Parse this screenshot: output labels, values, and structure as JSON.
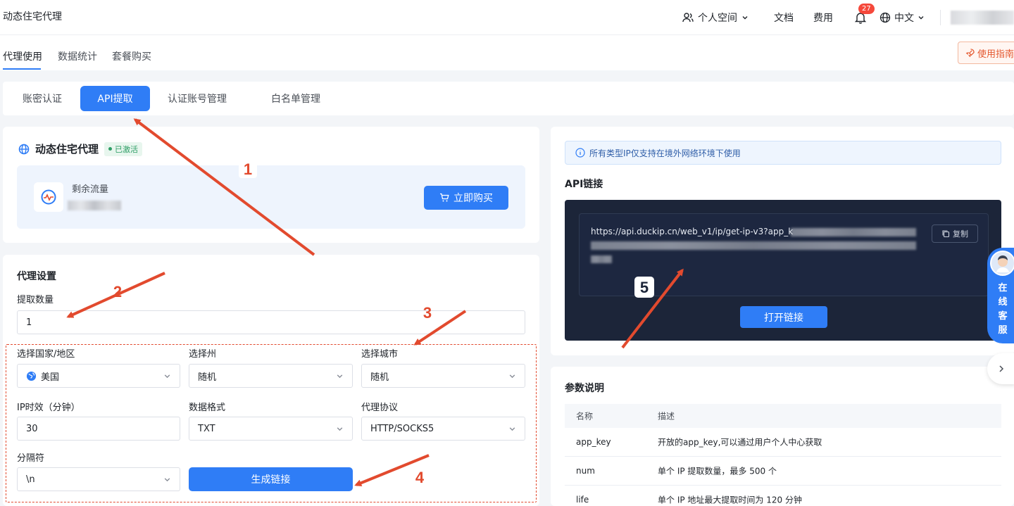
{
  "header": {
    "brand": "动态住宅代理",
    "space_label": "个人空间",
    "docs_label": "文档",
    "fees_label": "费用",
    "notification_count": "27",
    "lang_label": "中文"
  },
  "subnav": {
    "tabs": [
      {
        "label": "代理使用"
      },
      {
        "label": "数据统计"
      },
      {
        "label": "套餐购买"
      }
    ],
    "guide_label": "使用指南"
  },
  "mode_tabs": [
    {
      "label": "账密认证"
    },
    {
      "label": "API提取"
    },
    {
      "label": "认证账号管理"
    },
    {
      "label": "白名单管理"
    }
  ],
  "product": {
    "title": "动态住宅代理",
    "status": "已激活",
    "traffic_label": "剩余流量",
    "buy_label": "立即购买"
  },
  "settings": {
    "title": "代理设置",
    "quantity_label": "提取数量",
    "quantity_value": "1",
    "country_label": "选择国家/地区",
    "country_value": "美国",
    "state_label": "选择州",
    "state_value": "随机",
    "city_label": "选择城市",
    "city_value": "随机",
    "ttl_label": "IP时效（分钟）",
    "ttl_value": "30",
    "format_label": "数据格式",
    "format_value": "TXT",
    "protocol_label": "代理协议",
    "protocol_value": "HTTP/SOCKS5",
    "separator_label": "分隔符",
    "separator_value": "\\n",
    "generate_label": "生成链接"
  },
  "api": {
    "notice": "所有类型IP仅支持在境外网络环境下使用",
    "title": "API链接",
    "url_prefix": "https://api.duckip.cn/web_v1/ip/get-ip-v3?app_k",
    "copy_label": "复制",
    "open_label": "打开链接"
  },
  "params": {
    "title": "参数说明",
    "headers": [
      "名称",
      "描述"
    ],
    "rows": [
      {
        "name": "app_key",
        "desc": "开放的app_key,可以通过用户个人中心获取"
      },
      {
        "name": "num",
        "desc": "单个 IP 提取数量，最多 500 个"
      },
      {
        "name": "life",
        "desc": "单个 IP 地址最大提取时间为 120 分钟"
      }
    ]
  },
  "customer_service": {
    "label": "在线客服"
  },
  "annotations": {
    "numbers": [
      "1",
      "2",
      "3",
      "4",
      "5"
    ]
  },
  "colors": {
    "primary": "#2f7df6",
    "annotation": "#e24a2e",
    "dark_panel": "#1c2539"
  }
}
